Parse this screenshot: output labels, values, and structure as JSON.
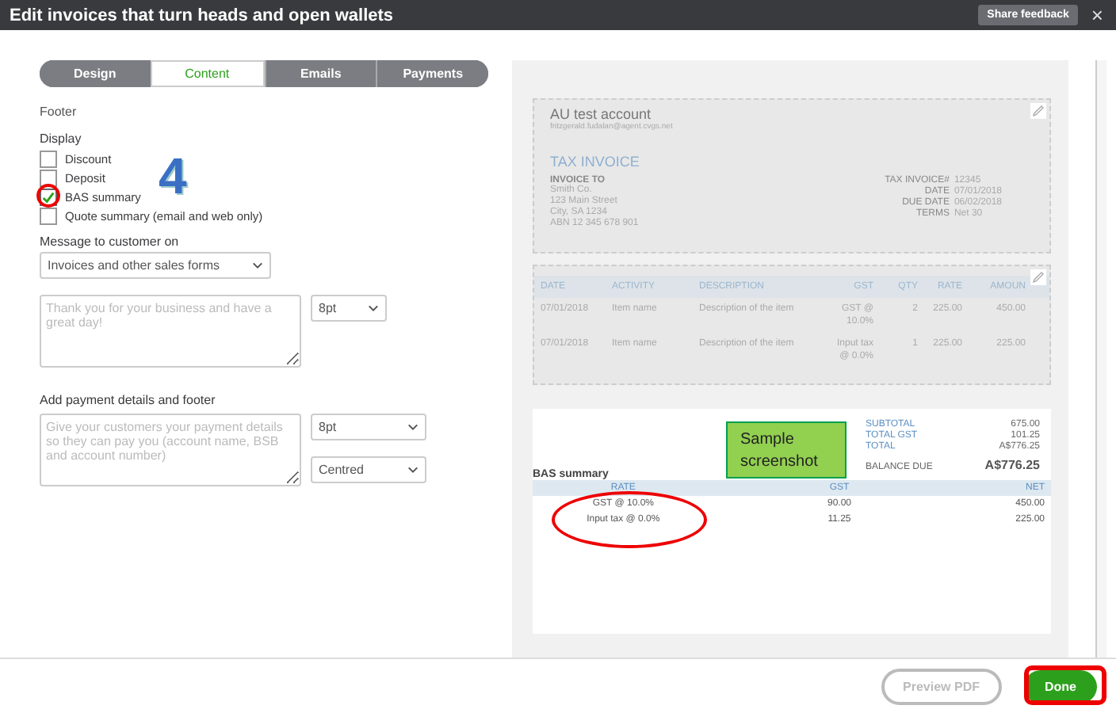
{
  "window": {
    "title": "Edit invoices that turn heads and open wallets",
    "feedback_button": "Share feedback",
    "close": "×"
  },
  "tabs": [
    {
      "label": "Design",
      "selected": false
    },
    {
      "label": "Content",
      "selected": true
    },
    {
      "label": "Emails",
      "selected": false
    },
    {
      "label": "Payments",
      "selected": false
    }
  ],
  "section_title": "Footer",
  "display": {
    "label": "Display",
    "items": [
      {
        "label": "Discount",
        "checked": false
      },
      {
        "label": "Deposit",
        "checked": false
      },
      {
        "label": "BAS summary",
        "checked": true
      },
      {
        "label": "Quote summary (email and web only)",
        "checked": false
      }
    ]
  },
  "message": {
    "label": "Message to customer on",
    "select": "Invoices and other sales forms",
    "placeholder": "Thank you for your business and have a great day!",
    "size": "8pt"
  },
  "payment": {
    "label": "Add payment details and footer",
    "placeholder": "Give your customers your payment details so they can pay you (account name, BSB and account number)",
    "size": "8pt",
    "align": "Centred"
  },
  "preview": {
    "company": "AU test account",
    "email": "fritzgerald.fudalan@agent.cvgs.net",
    "doc_title": "TAX INVOICE",
    "bill_label": "INVOICE TO",
    "bill_lines": [
      "Smith Co.",
      "123 Main Street",
      "City, SA 1234",
      "ABN 12 345 678 901"
    ],
    "meta": [
      {
        "label": "TAX INVOICE#",
        "value": "12345"
      },
      {
        "label": "DATE",
        "value": "07/01/2018"
      },
      {
        "label": "DUE DATE",
        "value": "06/02/2018"
      },
      {
        "label": "TERMS",
        "value": "Net 30"
      }
    ],
    "columns": [
      "DATE",
      "ACTIVITY",
      "DESCRIPTION",
      "GST",
      "QTY",
      "RATE",
      "AMOUN"
    ],
    "rows": [
      [
        "07/01/2018",
        "Item name",
        "Description of the item",
        "GST @ 10.0%",
        "2",
        "225.00",
        "450.00"
      ],
      [
        "07/01/2018",
        "Item name",
        "Description of the item",
        "Input tax @ 0.0%",
        "1",
        "225.00",
        "225.00"
      ]
    ],
    "totals": [
      {
        "label": "SUBTOTAL",
        "value": "675.00"
      },
      {
        "label": "TOTAL GST",
        "value": "101.25"
      },
      {
        "label": "TOTAL",
        "value": "A$776.25"
      }
    ],
    "balance": {
      "label": "BALANCE DUE",
      "value": "A$776.25"
    },
    "bas": {
      "title": "BAS summary",
      "columns": [
        "RATE",
        "GST",
        "NET"
      ],
      "rows": [
        [
          "GST @ 10.0%",
          "90.00",
          "450.00"
        ],
        [
          "Input tax @ 0.0%",
          "11.25",
          "225.00"
        ]
      ]
    }
  },
  "annotations": {
    "step": "4",
    "note": "Sample screenshot"
  },
  "buttons": {
    "preview": {
      "label": "Preview PDF",
      "disabled": true
    },
    "done": "Done"
  }
}
